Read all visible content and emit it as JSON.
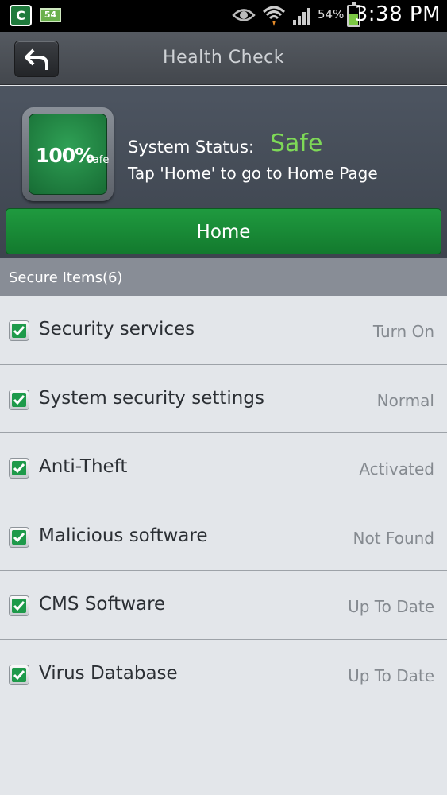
{
  "status_bar": {
    "app_icon_label": "C",
    "notification_badge": "54",
    "battery_percent": "54%",
    "battery_level": 0.54,
    "time": "3:38 PM"
  },
  "header": {
    "title": "Health Check",
    "back_icon": "back-arrow-icon"
  },
  "status_panel": {
    "score": "100%",
    "score_suffix": "safe",
    "status_label": "System Status:",
    "status_value": "Safe",
    "status_value_color": "#7ed957",
    "hint": "Tap 'Home' to go to Home Page",
    "home_button": "Home"
  },
  "section": {
    "title": "Secure Items(6)"
  },
  "items": [
    {
      "name": "Security services",
      "state": "Turn On"
    },
    {
      "name": "System security settings",
      "state": "Normal"
    },
    {
      "name": "Anti-Theft",
      "state": "Activated"
    },
    {
      "name": "Malicious software",
      "state": "Not Found"
    },
    {
      "name": "CMS Software",
      "state": "Up To Date"
    },
    {
      "name": "Virus Database",
      "state": "Up To Date"
    }
  ],
  "colors": {
    "accent_green": "#1f9a3f",
    "check_green": "#1e9a4a"
  }
}
